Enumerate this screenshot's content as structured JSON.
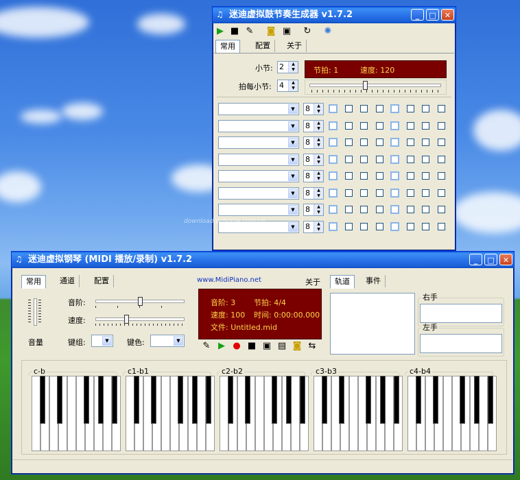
{
  "drum_window": {
    "title": "迷迪虚拟鼓节奏生成器 v1.7.2",
    "tabs": [
      "常用",
      "配置",
      "关于"
    ],
    "measure_label": "小节:",
    "measure_value": "2",
    "beats_label": "拍每小节:",
    "beats_value": "4",
    "beat_display": "节拍: 1",
    "tempo_display": "速度: 120",
    "tempo_slider_level": 0.55,
    "row_spin_value": "8",
    "rows": 8,
    "checkbox_columns": 8
  },
  "piano_window": {
    "title": "迷迪虚拟钢琴 (MIDI 播放/录制) v1.7.2",
    "tabs": [
      "常用",
      "通道",
      "配置"
    ],
    "website": "www.MidiPiano.net",
    "about_label": "关于",
    "track_tabs": [
      "轨道",
      "事件"
    ],
    "scale_label": "音阶:",
    "speed_label": "速度:",
    "volume_label": "音量",
    "keygroup_label": "键组:",
    "keycolor_label": "键色:",
    "status": {
      "scale": "音阶: 3",
      "beat": "节拍: 4/4",
      "speed": "速度: 100",
      "time": "时间: 0:00:00.000",
      "file": "文件: Untitled.mid"
    },
    "right_hand_label": "右手",
    "left_hand_label": "左手",
    "octave_labels": [
      "c-b",
      "c1-b1",
      "c2-b2",
      "c3-b3",
      "c4-b4"
    ],
    "scale_slider_level": 0.5,
    "speed_slider_level": 0.35
  },
  "watermark": "download.pchome.com.cn",
  "colors": {
    "titlebar": "#1f63df",
    "window_bg": "#ece9d8",
    "status_panel": "#7a0000",
    "status_text": "#ffd54a"
  }
}
